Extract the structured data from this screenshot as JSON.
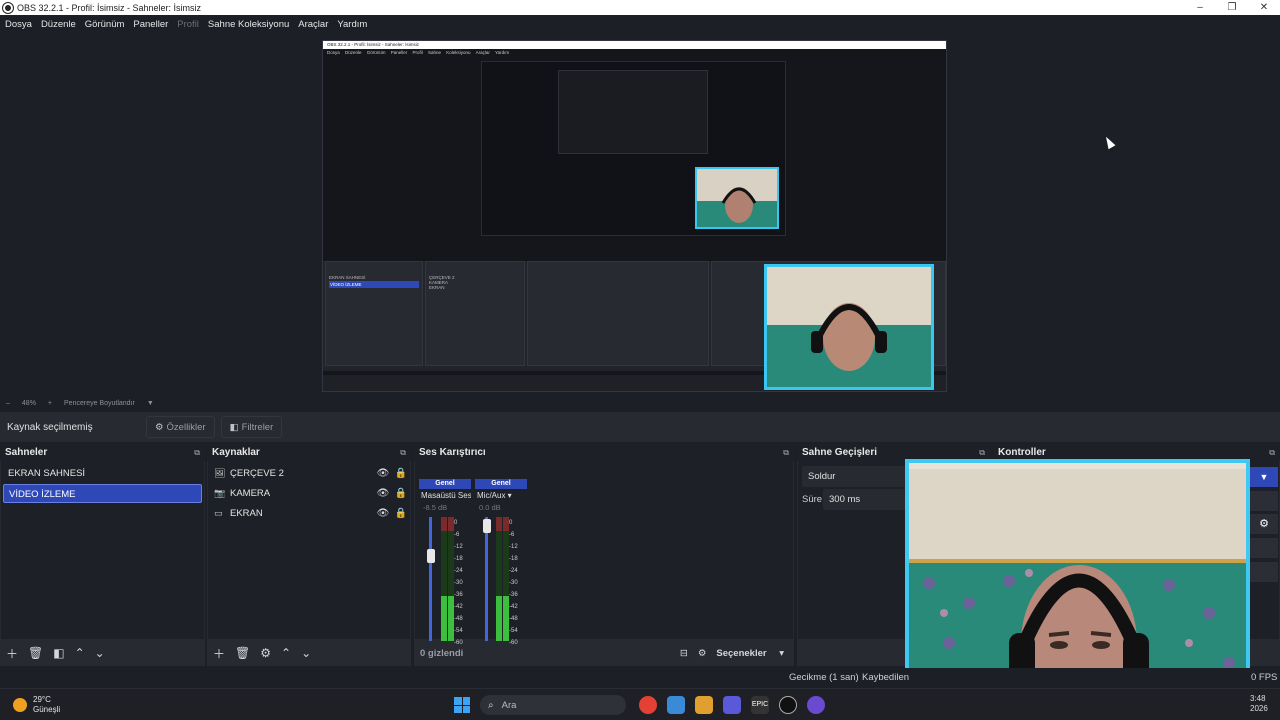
{
  "window": {
    "title": "OBS 32.2.1 - Profil: İsimsiz - Sahneler: İsimsiz",
    "buttons": [
      "–",
      "❐",
      "✕"
    ]
  },
  "menu": [
    {
      "label": "Dosya",
      "disabled": false
    },
    {
      "label": "Düzenle",
      "disabled": false
    },
    {
      "label": "Görünüm",
      "disabled": false
    },
    {
      "label": "Paneller",
      "disabled": false
    },
    {
      "label": "Profil",
      "disabled": true
    },
    {
      "label": "Sahne Koleksiyonu",
      "disabled": false
    },
    {
      "label": "Araçlar",
      "disabled": false
    },
    {
      "label": "Yardım",
      "disabled": false
    }
  ],
  "zoombar": {
    "minus": "–",
    "zoom": "48%",
    "plus": "+",
    "mode": "Pencereye Boyutlandır"
  },
  "context": {
    "label": "Kaynak seçilmemiş",
    "properties": "Özellikler",
    "filters": "Filtreler"
  },
  "scenes": {
    "title": "Sahneler",
    "items": [
      {
        "label": "EKRAN SAHNESİ",
        "selected": false
      },
      {
        "label": "VİDEO İZLEME",
        "selected": true
      }
    ]
  },
  "sources": {
    "title": "Kaynaklar",
    "items": [
      {
        "label": "ÇERÇEVE 2",
        "icon": "image-icon"
      },
      {
        "label": "KAMERA",
        "icon": "camera-icon"
      },
      {
        "label": "EKRAN",
        "icon": "monitor-icon"
      }
    ]
  },
  "mixer": {
    "title": "Ses Karıştırıcı",
    "channels": [
      {
        "tab": "Genel",
        "name": "Masaüstü Ses",
        "db": "-8.5 dB",
        "level": 0.36
      },
      {
        "tab": "Genel",
        "name": "Mic/Aux",
        "db": "0.0 dB",
        "level": 0.36
      }
    ],
    "ticks": [
      "0",
      "-6",
      "-12",
      "-18",
      "-24",
      "-30",
      "-36",
      "-42",
      "-48",
      "-54",
      "-60"
    ],
    "hidden": "0 gizlendi",
    "options": "Seçenekler"
  },
  "transitions": {
    "title": "Sahne Geçişleri",
    "transition": "Soldur",
    "duration_label": "Süre",
    "duration": "300 ms"
  },
  "controls": {
    "title": "Kontroller"
  },
  "status": {
    "delay": "Gecikme (1 san)",
    "dropped": "Kaybedilen",
    "fps": "0 FPS"
  },
  "taskbar": {
    "temp": "29°C",
    "weather": "Güneşli",
    "search": "Ara",
    "time": "3:48",
    "date": "2026"
  },
  "nested": {
    "title": "OBS 32.2.1 - Profil: İsimsiz - Sahneler: İsimsiz",
    "menu": "Dosya Düzenle Görünüm Paneller Profil Sahne Koleksiyonu Araçlar Yardım",
    "scene1": "EKRAN SAHNESİ",
    "scene2": "VİDEO İZLEME",
    "src1": "ÇERÇEVE 2",
    "src2": "KAMERA",
    "src3": "EKRAN"
  }
}
